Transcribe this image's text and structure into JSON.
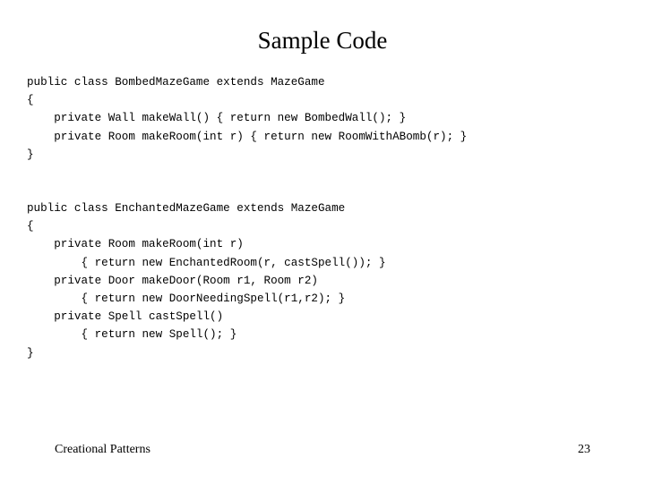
{
  "slide": {
    "title": "Sample Code",
    "code_blocks": [
      {
        "lines": [
          "public class BombedMazeGame extends MazeGame",
          "{",
          "    private Wall makeWall() { return new BombedWall(); }",
          "    private Room makeRoom(int r) { return new RoomWithABomb(r); }",
          "}"
        ]
      },
      {
        "lines": [
          "public class EnchantedMazeGame extends MazeGame",
          "{",
          "    private Room makeRoom(int r)",
          "        { return new EnchantedRoom(r, castSpell()); }",
          "    private Door makeDoor(Room r1, Room r2)",
          "        { return new DoorNeedingSpell(r1,r2); }",
          "    private Spell castSpell()",
          "        { return new Spell(); }",
          "}"
        ]
      }
    ],
    "footer": {
      "label": "Creational Patterns",
      "page_number": "23"
    }
  }
}
